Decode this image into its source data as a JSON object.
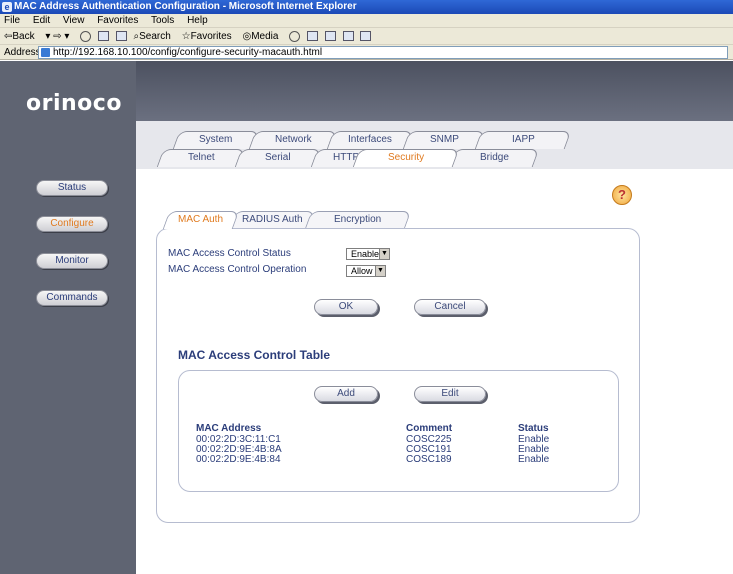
{
  "window": {
    "title": "MAC Address Authentication Configuration - Microsoft Internet Explorer"
  },
  "menu": [
    "File",
    "Edit",
    "View",
    "Favorites",
    "Tools",
    "Help"
  ],
  "toolbar": {
    "back": "⇦Back",
    "search": "Search",
    "favorites": "Favorites",
    "media": "Media"
  },
  "address": {
    "label": "Address",
    "url": "http://192.168.10.100/config/configure-security-macauth.html"
  },
  "logo": "orinoco",
  "sidebar": [
    {
      "label": "Status"
    },
    {
      "label": "Configure"
    },
    {
      "label": "Monitor"
    },
    {
      "label": "Commands"
    }
  ],
  "tabs_row1": [
    "System",
    "Network",
    "Interfaces",
    "SNMP",
    "IAPP"
  ],
  "tabs_row2": [
    "Telnet",
    "Serial",
    "HTTP",
    "Security",
    "Bridge"
  ],
  "help_icon": "?",
  "subtabs": [
    "MAC Auth",
    "RADIUS Auth",
    "Encryption"
  ],
  "form": {
    "status_label": "MAC Access Control Status",
    "status_value": "Enable",
    "operation_label": "MAC Access Control Operation",
    "operation_value": "Allow",
    "ok": "OK",
    "cancel": "Cancel"
  },
  "table": {
    "title": "MAC Access Control Table",
    "add": "Add",
    "edit": "Edit",
    "columns": [
      "MAC Address",
      "Comment",
      "Status"
    ],
    "rows": [
      [
        "00:02:2D:3C:11:C1",
        "COSC225",
        "Enable"
      ],
      [
        "00:02:2D:9E:4B:8A",
        "COSC191",
        "Enable"
      ],
      [
        "00:02:2D:9E:4B:84",
        "COSC189",
        "Enable"
      ]
    ]
  }
}
